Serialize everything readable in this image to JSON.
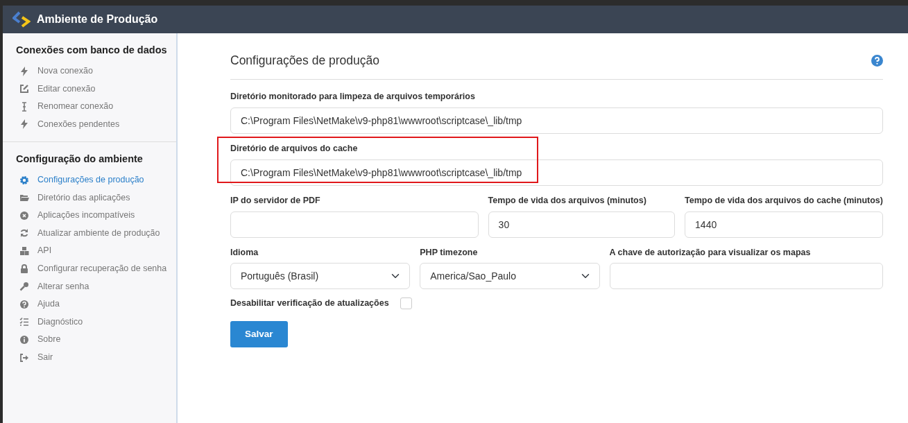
{
  "app_bar": {
    "title": "Ambiente de Produção"
  },
  "sidebar": {
    "sections": [
      {
        "title": "Conexões com banco de dados",
        "items": [
          {
            "label": "Nova conexão",
            "selected": false
          },
          {
            "label": "Editar conexão",
            "selected": false
          },
          {
            "label": "Renomear conexão",
            "selected": false
          },
          {
            "label": "Conexões pendentes",
            "selected": false
          }
        ]
      },
      {
        "title": "Configuração do ambiente",
        "items": [
          {
            "label": "Configurações de produção",
            "selected": true
          },
          {
            "label": "Diretório das aplicações",
            "selected": false
          },
          {
            "label": "Aplicações incompatíveis",
            "selected": false
          },
          {
            "label": "Atualizar ambiente de produção",
            "selected": false
          },
          {
            "label": "API",
            "selected": false
          },
          {
            "label": "Configurar recuperação de senha",
            "selected": false
          },
          {
            "label": "Alterar senha",
            "selected": false
          },
          {
            "label": "Ajuda",
            "selected": false
          },
          {
            "label": "Diagnóstico",
            "selected": false
          },
          {
            "label": "Sobre",
            "selected": false
          },
          {
            "label": "Sair",
            "selected": false
          }
        ]
      }
    ]
  },
  "form": {
    "title": "Configurações de produção",
    "rows": [
      {
        "fields": [
          {
            "kind": "text",
            "label": "Diretório monitorado para limpeza de arquivos temporários",
            "value": "C:\\Program Files\\NetMake\\v9-php81\\wwwroot\\scriptcase\\_lib/tmp",
            "highlighted": false
          }
        ]
      },
      {
        "fields": [
          {
            "kind": "text",
            "label": "Diretório de arquivos do cache",
            "value": "C:\\Program Files\\NetMake\\v9-php81\\wwwroot\\scriptcase\\_lib/tmp",
            "highlighted": true
          }
        ]
      },
      {
        "fields": [
          {
            "kind": "text",
            "label": "IP do servidor de PDF",
            "highlighted": false
          },
          {
            "kind": "text",
            "label": "Tempo de vida dos arquivos (minutos)",
            "value": "30",
            "highlighted": false
          },
          {
            "kind": "text",
            "label": "Tempo de vida dos arquivos do cache (minutos)",
            "value": "1440",
            "highlighted": false
          }
        ]
      },
      {
        "fields": [
          {
            "kind": "select",
            "label": "Idioma",
            "value": "Português (Brasil)",
            "highlighted": false
          },
          {
            "kind": "select",
            "label": "PHP timezone",
            "value": "America/Sao_Paulo",
            "highlighted": false
          },
          {
            "kind": "text",
            "label": "A chave de autorização para visualizar os mapas",
            "highlighted": false
          }
        ]
      },
      {
        "fields": [
          {
            "kind": "checkbox",
            "label": "Desabilitar verificação de atualizações",
            "checked": false
          }
        ]
      }
    ],
    "submit": "Salvar"
  }
}
